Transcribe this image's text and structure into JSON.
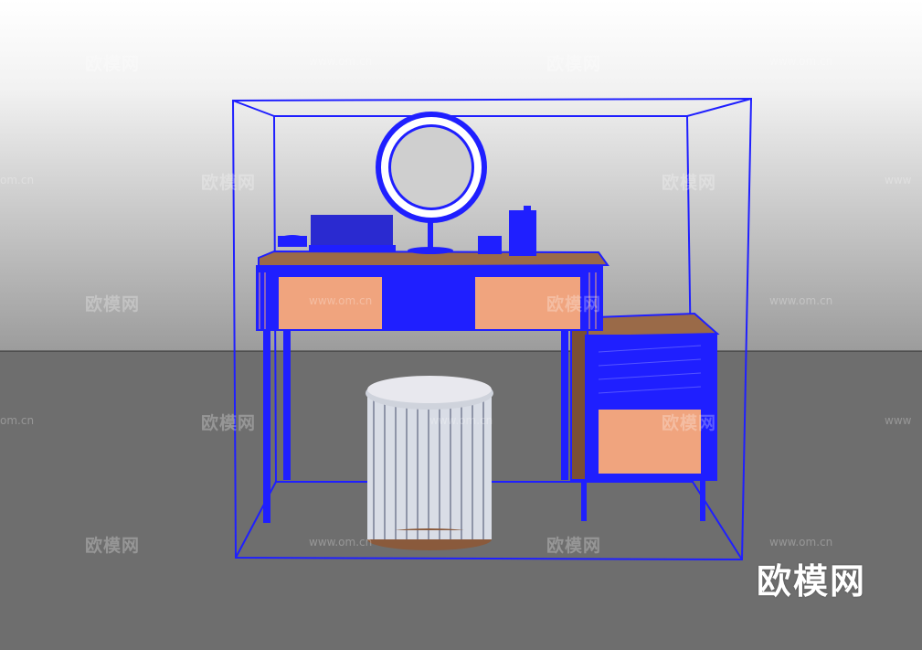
{
  "watermark": {
    "brand": "欧模网",
    "url": "www.om.cn",
    "url_partial_left": "om.cn",
    "url_partial_right": "www",
    "url_partial_stool": "www.om.cn"
  },
  "logo": "欧模网",
  "colors": {
    "wireframe": "#1f1fff",
    "drawer": "#f0a47e",
    "wood": "#8a5a3c",
    "floor": "#6e6e6e"
  }
}
